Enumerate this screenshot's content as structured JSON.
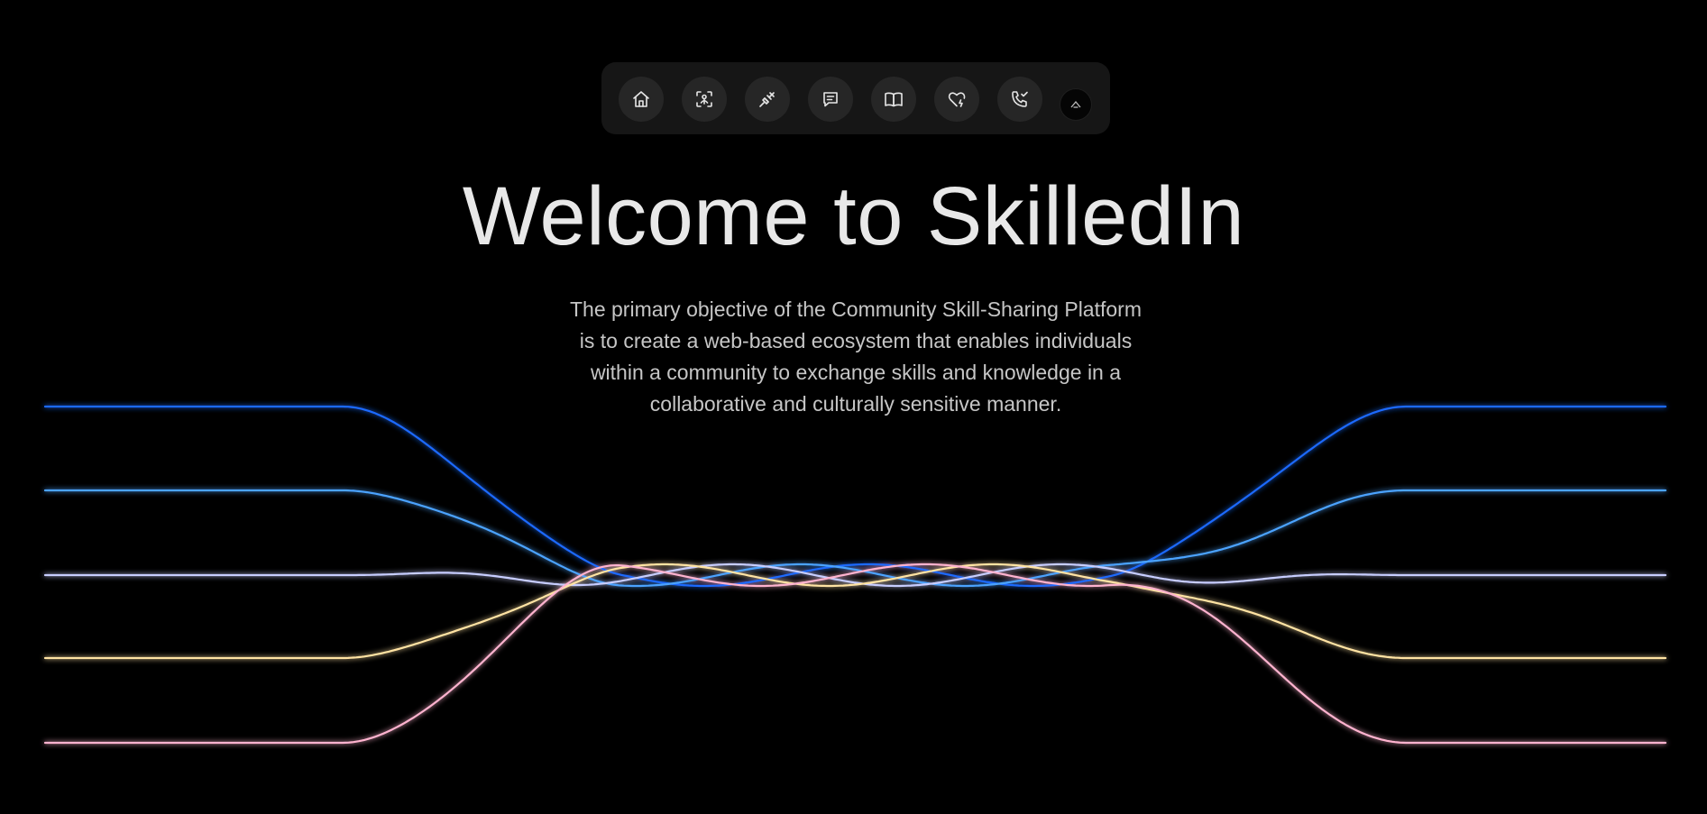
{
  "nav": {
    "items": [
      {
        "icon": "home-icon",
        "label": "Home"
      },
      {
        "icon": "scan-icon",
        "label": "Scan"
      },
      {
        "icon": "plug-icon",
        "label": "Connect"
      },
      {
        "icon": "message-icon",
        "label": "Messages"
      },
      {
        "icon": "book-icon",
        "label": "Learn"
      },
      {
        "icon": "heart-pulse-icon",
        "label": "Favorites"
      },
      {
        "icon": "phone-check-icon",
        "label": "Calls"
      }
    ],
    "avatar_icon": "avatar-icon"
  },
  "hero": {
    "title": "Welcome to SkilledIn",
    "description": "The primary objective of the Community Skill-Sharing Platform is to create a web-based ecosystem that enables individuals within a community to exchange skills and knowledge in a collaborative and culturally sensitive manner."
  },
  "colors": {
    "background": "#000000",
    "wave_blue_dark": "#1a6bff",
    "wave_blue_light": "#4ba3ff",
    "wave_lavender": "#c7cdff",
    "wave_yellow": "#ffe3a3",
    "wave_pink": "#ffb3cf"
  }
}
